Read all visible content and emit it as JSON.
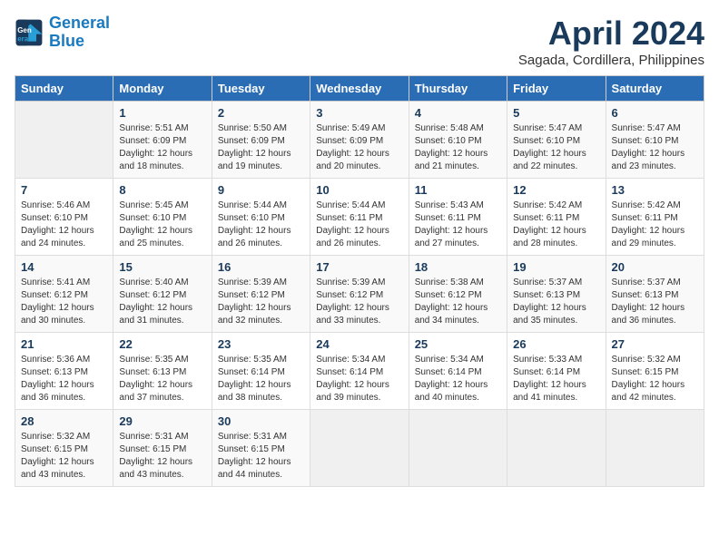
{
  "logo": {
    "line1": "General",
    "line2": "Blue"
  },
  "title": "April 2024",
  "subtitle": "Sagada, Cordillera, Philippines",
  "headers": [
    "Sunday",
    "Monday",
    "Tuesday",
    "Wednesday",
    "Thursday",
    "Friday",
    "Saturday"
  ],
  "weeks": [
    [
      {
        "day": "",
        "info": ""
      },
      {
        "day": "1",
        "info": "Sunrise: 5:51 AM\nSunset: 6:09 PM\nDaylight: 12 hours\nand 18 minutes."
      },
      {
        "day": "2",
        "info": "Sunrise: 5:50 AM\nSunset: 6:09 PM\nDaylight: 12 hours\nand 19 minutes."
      },
      {
        "day": "3",
        "info": "Sunrise: 5:49 AM\nSunset: 6:09 PM\nDaylight: 12 hours\nand 20 minutes."
      },
      {
        "day": "4",
        "info": "Sunrise: 5:48 AM\nSunset: 6:10 PM\nDaylight: 12 hours\nand 21 minutes."
      },
      {
        "day": "5",
        "info": "Sunrise: 5:47 AM\nSunset: 6:10 PM\nDaylight: 12 hours\nand 22 minutes."
      },
      {
        "day": "6",
        "info": "Sunrise: 5:47 AM\nSunset: 6:10 PM\nDaylight: 12 hours\nand 23 minutes."
      }
    ],
    [
      {
        "day": "7",
        "info": "Sunrise: 5:46 AM\nSunset: 6:10 PM\nDaylight: 12 hours\nand 24 minutes."
      },
      {
        "day": "8",
        "info": "Sunrise: 5:45 AM\nSunset: 6:10 PM\nDaylight: 12 hours\nand 25 minutes."
      },
      {
        "day": "9",
        "info": "Sunrise: 5:44 AM\nSunset: 6:10 PM\nDaylight: 12 hours\nand 26 minutes."
      },
      {
        "day": "10",
        "info": "Sunrise: 5:44 AM\nSunset: 6:11 PM\nDaylight: 12 hours\nand 26 minutes."
      },
      {
        "day": "11",
        "info": "Sunrise: 5:43 AM\nSunset: 6:11 PM\nDaylight: 12 hours\nand 27 minutes."
      },
      {
        "day": "12",
        "info": "Sunrise: 5:42 AM\nSunset: 6:11 PM\nDaylight: 12 hours\nand 28 minutes."
      },
      {
        "day": "13",
        "info": "Sunrise: 5:42 AM\nSunset: 6:11 PM\nDaylight: 12 hours\nand 29 minutes."
      }
    ],
    [
      {
        "day": "14",
        "info": "Sunrise: 5:41 AM\nSunset: 6:12 PM\nDaylight: 12 hours\nand 30 minutes."
      },
      {
        "day": "15",
        "info": "Sunrise: 5:40 AM\nSunset: 6:12 PM\nDaylight: 12 hours\nand 31 minutes."
      },
      {
        "day": "16",
        "info": "Sunrise: 5:39 AM\nSunset: 6:12 PM\nDaylight: 12 hours\nand 32 minutes."
      },
      {
        "day": "17",
        "info": "Sunrise: 5:39 AM\nSunset: 6:12 PM\nDaylight: 12 hours\nand 33 minutes."
      },
      {
        "day": "18",
        "info": "Sunrise: 5:38 AM\nSunset: 6:12 PM\nDaylight: 12 hours\nand 34 minutes."
      },
      {
        "day": "19",
        "info": "Sunrise: 5:37 AM\nSunset: 6:13 PM\nDaylight: 12 hours\nand 35 minutes."
      },
      {
        "day": "20",
        "info": "Sunrise: 5:37 AM\nSunset: 6:13 PM\nDaylight: 12 hours\nand 36 minutes."
      }
    ],
    [
      {
        "day": "21",
        "info": "Sunrise: 5:36 AM\nSunset: 6:13 PM\nDaylight: 12 hours\nand 36 minutes."
      },
      {
        "day": "22",
        "info": "Sunrise: 5:35 AM\nSunset: 6:13 PM\nDaylight: 12 hours\nand 37 minutes."
      },
      {
        "day": "23",
        "info": "Sunrise: 5:35 AM\nSunset: 6:14 PM\nDaylight: 12 hours\nand 38 minutes."
      },
      {
        "day": "24",
        "info": "Sunrise: 5:34 AM\nSunset: 6:14 PM\nDaylight: 12 hours\nand 39 minutes."
      },
      {
        "day": "25",
        "info": "Sunrise: 5:34 AM\nSunset: 6:14 PM\nDaylight: 12 hours\nand 40 minutes."
      },
      {
        "day": "26",
        "info": "Sunrise: 5:33 AM\nSunset: 6:14 PM\nDaylight: 12 hours\nand 41 minutes."
      },
      {
        "day": "27",
        "info": "Sunrise: 5:32 AM\nSunset: 6:15 PM\nDaylight: 12 hours\nand 42 minutes."
      }
    ],
    [
      {
        "day": "28",
        "info": "Sunrise: 5:32 AM\nSunset: 6:15 PM\nDaylight: 12 hours\nand 43 minutes."
      },
      {
        "day": "29",
        "info": "Sunrise: 5:31 AM\nSunset: 6:15 PM\nDaylight: 12 hours\nand 43 minutes."
      },
      {
        "day": "30",
        "info": "Sunrise: 5:31 AM\nSunset: 6:15 PM\nDaylight: 12 hours\nand 44 minutes."
      },
      {
        "day": "",
        "info": ""
      },
      {
        "day": "",
        "info": ""
      },
      {
        "day": "",
        "info": ""
      },
      {
        "day": "",
        "info": ""
      }
    ]
  ]
}
